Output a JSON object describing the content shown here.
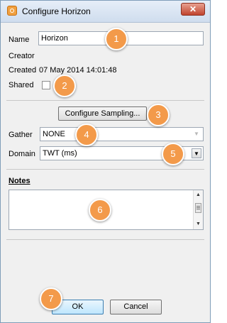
{
  "window": {
    "title": "Configure Horizon",
    "close_glyph": "✕"
  },
  "form": {
    "name_label": "Name",
    "name_value": "Horizon",
    "creator_label": "Creator",
    "created_label": "Created",
    "created_value": "07 May 2014 14:01:48",
    "shared_label": "Shared",
    "configure_sampling_label": "Configure Sampling...",
    "gather_label": "Gather",
    "gather_value": "NONE",
    "domain_label": "Domain",
    "domain_value": "TWT (ms)",
    "notes_label": "Notes",
    "notes_value": ""
  },
  "buttons": {
    "ok": "OK",
    "cancel": "Cancel"
  },
  "markers": [
    "1",
    "2",
    "3",
    "4",
    "5",
    "6",
    "7"
  ],
  "colors": {
    "marker": "#f39a4a",
    "title_bar": "#cfddee",
    "close": "#c0442e"
  },
  "icons": {
    "app": "horizon-app-icon",
    "close": "close-icon",
    "dropdown": "chevron-down-icon"
  }
}
